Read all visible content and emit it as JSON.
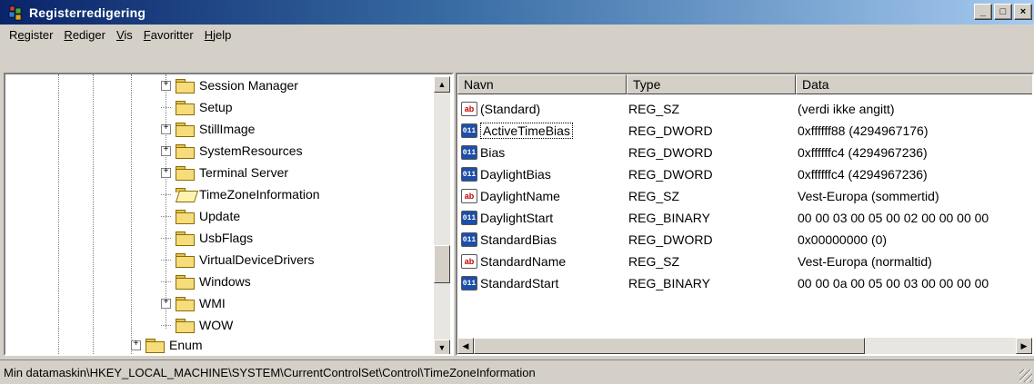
{
  "window": {
    "title": "Registerredigering",
    "controls": {
      "minimize": "_",
      "maximize": "□",
      "close": "×"
    }
  },
  "menu": [
    {
      "label": "Register",
      "accel": "e"
    },
    {
      "label": "Rediger",
      "accel": "R"
    },
    {
      "label": "Vis",
      "accel": "V"
    },
    {
      "label": "Favoritter",
      "accel": "F"
    },
    {
      "label": "Hjelp",
      "accel": "H"
    }
  ],
  "tree": {
    "items": [
      {
        "label": "Session Manager",
        "expandable": true,
        "expander": "+"
      },
      {
        "label": "Setup",
        "expandable": false
      },
      {
        "label": "StillImage",
        "expandable": true,
        "expander": "+"
      },
      {
        "label": "SystemResources",
        "expandable": true,
        "expander": "+"
      },
      {
        "label": "Terminal Server",
        "expandable": true,
        "expander": "+"
      },
      {
        "label": "TimeZoneInformation",
        "expandable": false,
        "selected": true
      },
      {
        "label": "Update",
        "expandable": false
      },
      {
        "label": "UsbFlags",
        "expandable": false
      },
      {
        "label": "VirtualDeviceDrivers",
        "expandable": false
      },
      {
        "label": "Windows",
        "expandable": false
      },
      {
        "label": "WMI",
        "expandable": true,
        "expander": "+"
      },
      {
        "label": "WOW",
        "expandable": false
      },
      {
        "label": "Enum",
        "expandable": true,
        "expander": "+"
      }
    ]
  },
  "list": {
    "columns": [
      "Navn",
      "Type",
      "Data"
    ],
    "rows": [
      {
        "icon": "ab",
        "kind": "string-value-icon",
        "name": "(Standard)",
        "type": "REG_SZ",
        "data": "(verdi ikke angitt)"
      },
      {
        "icon": "011",
        "kind": "binary-value-icon",
        "name": "ActiveTimeBias",
        "type": "REG_DWORD",
        "data": "0xffffff88 (4294967176)",
        "focused": true
      },
      {
        "icon": "011",
        "kind": "binary-value-icon",
        "name": "Bias",
        "type": "REG_DWORD",
        "data": "0xffffffc4 (4294967236)"
      },
      {
        "icon": "011",
        "kind": "binary-value-icon",
        "name": "DaylightBias",
        "type": "REG_DWORD",
        "data": "0xffffffc4 (4294967236)"
      },
      {
        "icon": "ab",
        "kind": "string-value-icon",
        "name": "DaylightName",
        "type": "REG_SZ",
        "data": "Vest-Europa (sommertid)"
      },
      {
        "icon": "011",
        "kind": "binary-value-icon",
        "name": "DaylightStart",
        "type": "REG_BINARY",
        "data": "00 00 03 00 05 00 02 00 00 00 00"
      },
      {
        "icon": "011",
        "kind": "binary-value-icon",
        "name": "StandardBias",
        "type": "REG_DWORD",
        "data": "0x00000000 (0)"
      },
      {
        "icon": "ab",
        "kind": "string-value-icon",
        "name": "StandardName",
        "type": "REG_SZ",
        "data": "Vest-Europa (normaltid)"
      },
      {
        "icon": "011",
        "kind": "binary-value-icon",
        "name": "StandardStart",
        "type": "REG_BINARY",
        "data": "00 00 0a 00 05 00 03 00 00 00 00"
      }
    ]
  },
  "status": {
    "path": "Min datamaskin\\HKEY_LOCAL_MACHINE\\SYSTEM\\CurrentControlSet\\Control\\TimeZoneInformation"
  }
}
